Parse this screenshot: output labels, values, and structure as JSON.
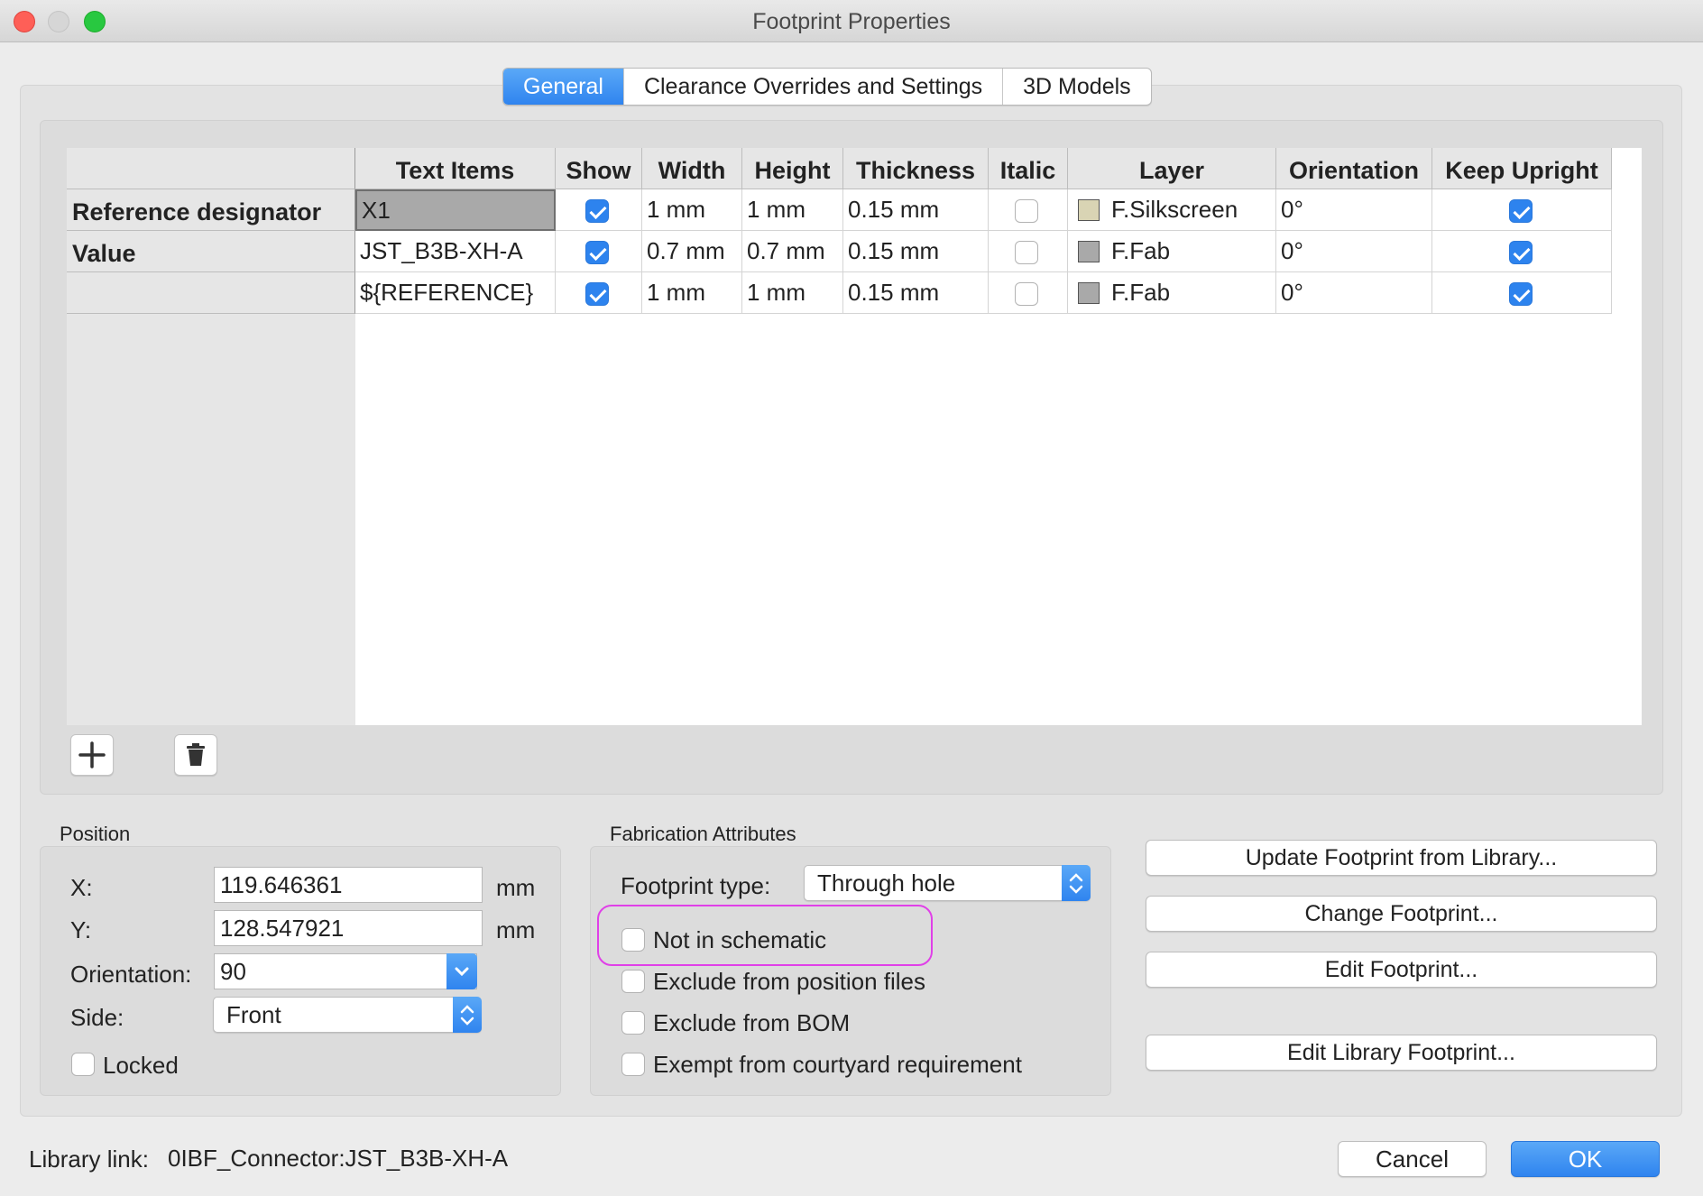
{
  "window": {
    "title": "Footprint Properties"
  },
  "tabs": [
    "General",
    "Clearance Overrides and Settings",
    "3D Models"
  ],
  "grid": {
    "headers": [
      "Text Items",
      "Show",
      "Width",
      "Height",
      "Thickness",
      "Italic",
      "Layer",
      "Orientation",
      "Keep Upright"
    ],
    "rows": [
      {
        "label": "Reference designator",
        "text": "X1",
        "show": true,
        "width": "1 mm",
        "height": "1 mm",
        "thickness": "0.15 mm",
        "italic": false,
        "layer": "F.Silkscreen",
        "layer_color": "#d9d4b4",
        "orientation": "0°",
        "keep_upright": true
      },
      {
        "label": "Value",
        "text": "JST_B3B-XH-A",
        "show": true,
        "width": "0.7 mm",
        "height": "0.7 mm",
        "thickness": "0.15 mm",
        "italic": false,
        "layer": "F.Fab",
        "layer_color": "#a9a9a9",
        "orientation": "0°",
        "keep_upright": true
      },
      {
        "label": "",
        "text": "${REFERENCE}",
        "show": true,
        "width": "1 mm",
        "height": "1 mm",
        "thickness": "0.15 mm",
        "italic": false,
        "layer": "F.Fab",
        "layer_color": "#a9a9a9",
        "orientation": "0°",
        "keep_upright": true
      }
    ],
    "add_icon": "plus-icon",
    "delete_icon": "trash-icon"
  },
  "position": {
    "group_label": "Position",
    "x_label": "X:",
    "x_value": "119.646361",
    "x_unit": "mm",
    "y_label": "Y:",
    "y_value": "128.547921",
    "y_unit": "mm",
    "orientation_label": "Orientation:",
    "orientation_value": "90",
    "side_label": "Side:",
    "side_value": "Front",
    "locked_label": "Locked"
  },
  "fabrication": {
    "group_label": "Fabrication Attributes",
    "type_label": "Footprint type:",
    "type_value": "Through hole",
    "not_in_schematic": "Not in schematic",
    "exclude_position": "Exclude from position files",
    "exclude_bom": "Exclude from BOM",
    "exempt_courtyard": "Exempt from courtyard requirement",
    "highlight_color": "#e040e8"
  },
  "actions": {
    "update": "Update Footprint from Library...",
    "change": "Change Footprint...",
    "edit": "Edit Footprint...",
    "edit_library": "Edit Library Footprint..."
  },
  "footer": {
    "library_link_label": "Library link:",
    "library_link_value": "0IBF_Connector:JST_B3B-XH-A",
    "cancel": "Cancel",
    "ok": "OK"
  },
  "colors": {
    "accent": "#2f84ef"
  }
}
